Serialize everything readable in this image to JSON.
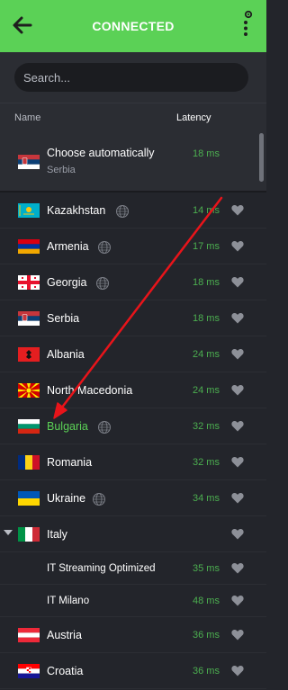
{
  "header": {
    "title": "CONNECTED"
  },
  "search": {
    "placeholder": "Search..."
  },
  "columns": {
    "name": "Name",
    "latency": "Latency"
  },
  "auto": {
    "name": "Choose automatically",
    "subtitle": "Serbia",
    "latency": "18 ms"
  },
  "countries": [
    {
      "name": "Kazakhstan",
      "latency": "14 ms",
      "flag": "kz-flag",
      "streaming": true
    },
    {
      "name": "Armenia",
      "latency": "17 ms",
      "flag": "am-flag",
      "streaming": true
    },
    {
      "name": "Georgia",
      "latency": "18 ms",
      "flag": "ge-flag",
      "streaming": true
    },
    {
      "name": "Serbia",
      "latency": "18 ms",
      "flag": "rs-flag",
      "streaming": false
    },
    {
      "name": "Albania",
      "latency": "24 ms",
      "flag": "al-flag",
      "streaming": false
    },
    {
      "name": "North Macedonia",
      "latency": "24 ms",
      "flag": "mk-flag",
      "streaming": false
    },
    {
      "name": "Bulgaria",
      "latency": "32 ms",
      "flag": "bg-flag",
      "streaming": true,
      "selected": true
    },
    {
      "name": "Romania",
      "latency": "32 ms",
      "flag": "ro-flag",
      "streaming": false
    },
    {
      "name": "Ukraine",
      "latency": "34 ms",
      "flag": "ua-flag",
      "streaming": true
    },
    {
      "name": "Italy",
      "latency": "",
      "flag": "it-flag",
      "streaming": false,
      "expanded": true
    },
    {
      "name": "Austria",
      "latency": "36 ms",
      "flag": "at-flag",
      "streaming": false
    },
    {
      "name": "Croatia",
      "latency": "36 ms",
      "flag": "hr-flag",
      "streaming": false
    }
  ],
  "italy_servers": [
    {
      "name": "IT Streaming Optimized",
      "latency": "35 ms"
    },
    {
      "name": "IT Milano",
      "latency": "48 ms"
    }
  ],
  "colors": {
    "accent": "#5bd156",
    "latency": "#4caf50",
    "background": "#23252b",
    "annotation": "#e8141a"
  },
  "icons": {
    "back": "arrow-left-icon",
    "menu": "settings-menu-icon",
    "favorite": "heart-icon",
    "streaming": "streaming-globe-icon",
    "expand": "triangle-down-icon"
  }
}
